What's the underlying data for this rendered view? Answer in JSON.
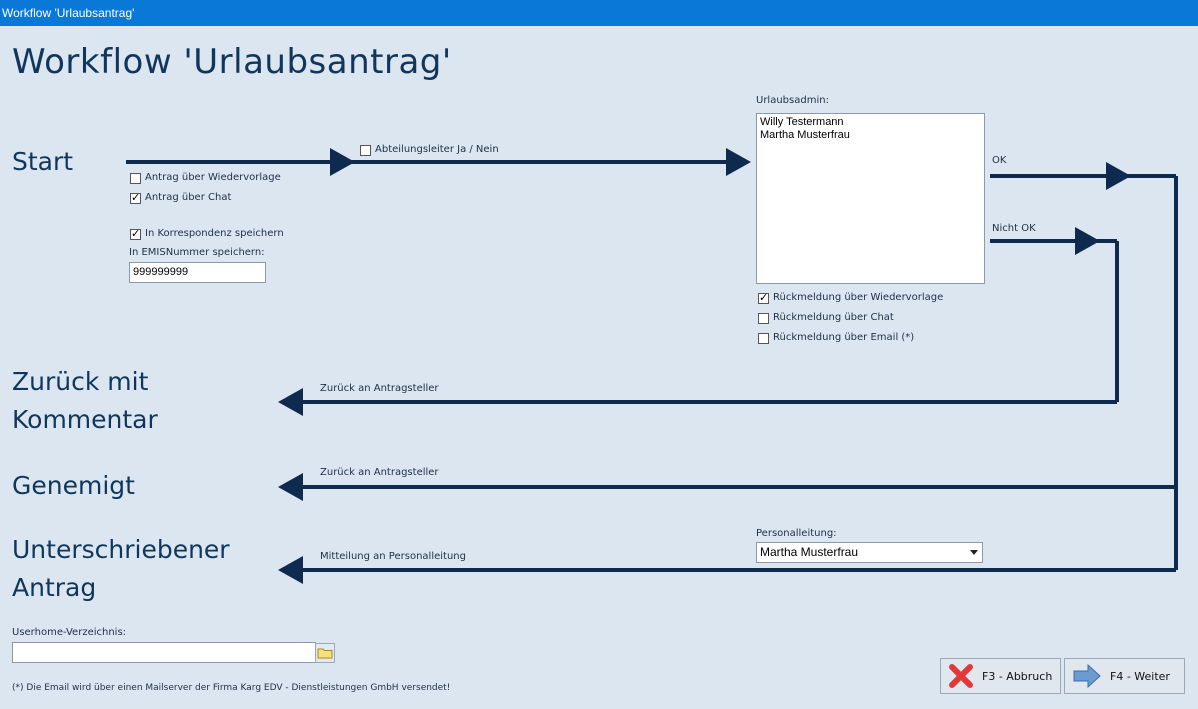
{
  "window": {
    "title": "Workflow 'Urlaubsantrag'"
  },
  "heading": "Workflow 'Urlaubsantrag'",
  "stages": {
    "start": "Start",
    "zurueck_line1": "Zurück mit",
    "zurueck_line2": "Kommentar",
    "genemigt": "Genemigt",
    "unterschrieben_line1": "Unterschriebener",
    "unterschrieben_line2": "Antrag"
  },
  "start_options": {
    "abteilungsleiter": {
      "label": "Abteilungsleiter Ja / Nein",
      "checked": false
    },
    "wiedervorlage": {
      "label": "Antrag über Wiedervorlage",
      "checked": false
    },
    "chat": {
      "label": "Antrag über Chat",
      "checked": true
    },
    "korrespondenz": {
      "label": "In Korrespondenz speichern",
      "checked": true
    },
    "emis_label": "In EMISNummer speichern:",
    "emis_value": "999999999"
  },
  "urlaubsadmin": {
    "label": "Urlaubsadmin:",
    "items": [
      "Willy Testermann",
      "Martha Musterfrau"
    ],
    "ok_label": "OK",
    "nicht_ok_label": "Nicht OK",
    "rueck_wiedervorlage": {
      "label": "Rückmeldung über Wiedervorlage",
      "checked": true
    },
    "rueck_chat": {
      "label": "Rückmeldung über Chat",
      "checked": false
    },
    "rueck_email": {
      "label": "Rückmeldung über Email (*)",
      "checked": false
    }
  },
  "arrows": {
    "zurueck": "Zurück an Antragsteller",
    "genemigt": "Zurück an Antragsteller",
    "personal": "Mitteilung an Personalleitung"
  },
  "personalleitung": {
    "label": "Personalleitung:",
    "value": "Martha Musterfrau"
  },
  "userhome": {
    "label": "Userhome-Verzeichnis:",
    "value": ""
  },
  "footnote": "(*) Die Email wird über einen Mailserver der Firma Karg EDV - Dienstleistungen GmbH versendet!",
  "buttons": {
    "abbruch": "F3 - Abbruch",
    "weiter": "F4 - Weiter"
  },
  "colors": {
    "titlebar": "#0a78d7",
    "background": "#dce6f1",
    "flow": "#0e2a4e"
  },
  "icons": {
    "abbruch": "red-x-icon",
    "weiter": "right-arrow-icon",
    "folder": "folder-icon"
  }
}
